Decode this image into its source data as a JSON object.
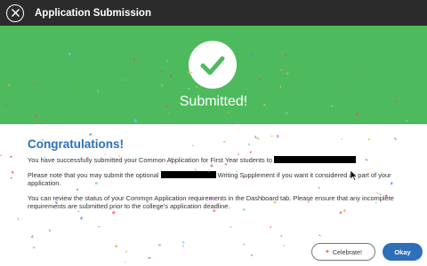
{
  "window": {
    "title": "Application Submission",
    "close_icon": "close-icon"
  },
  "banner": {
    "icon": "check-icon",
    "status": "Submitted!",
    "color": "#4dbb5d"
  },
  "content": {
    "heading": "Congratulations!",
    "p1_before": "You have successfully submitted your Common Application for First Year students to ",
    "p2_before": "Please note that you may submit the optional ",
    "p2_after": " Writing Supplement if you want it considered as part of your application.",
    "p3": "You can review the status of your Common Application requirements in the Dashboard tab. Please ensure that any incomplete requirements are submitted prior to the college's application deadline."
  },
  "buttons": {
    "celebrate_label": "Celebrate!",
    "celebrate_icon": "party-popper-icon",
    "okay_label": "Okay"
  },
  "colors": {
    "titlebar": "#2b2b2b",
    "heading": "#2d6fb8",
    "primary_button": "#2f6fb9"
  }
}
